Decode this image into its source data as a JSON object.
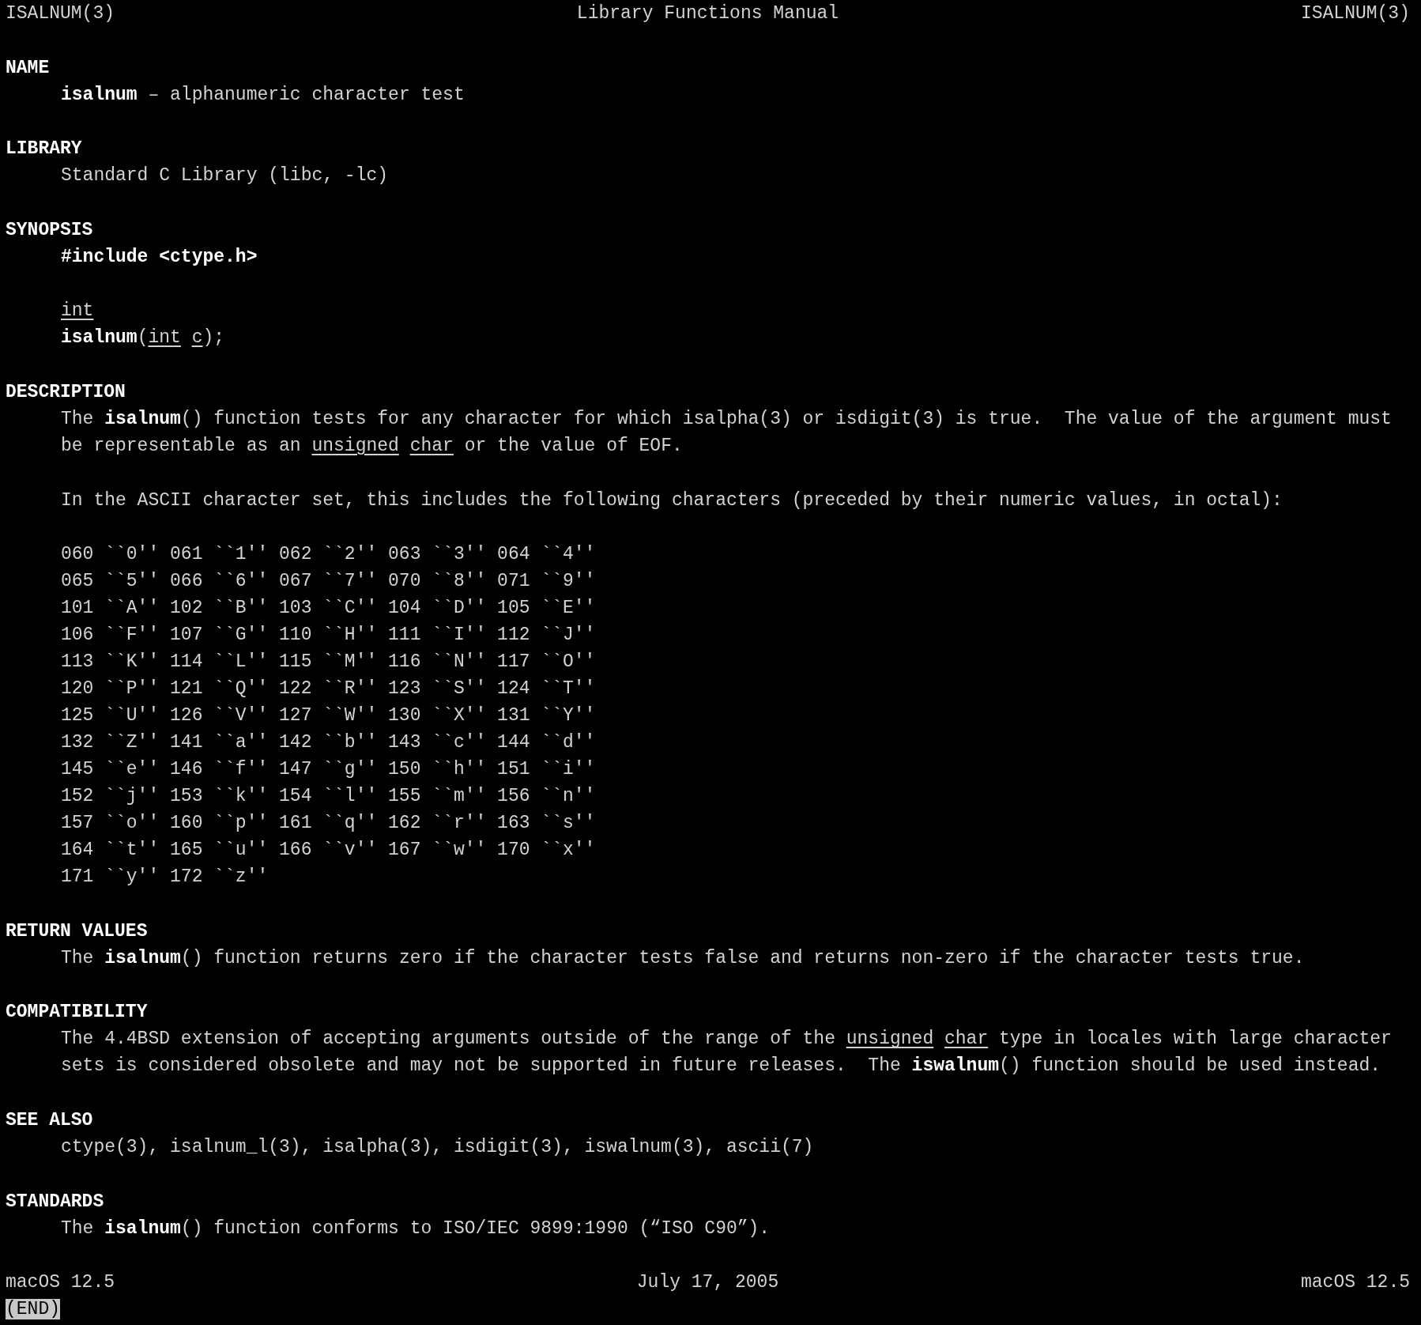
{
  "header": {
    "left": "ISALNUM(3)",
    "center": "Library Functions Manual",
    "right": "ISALNUM(3)"
  },
  "sections": [
    {
      "heading": "NAME",
      "paragraphs": [
        [
          [
            {
              "text": "isalnum",
              "kind": "bold"
            },
            {
              "text": " – alphanumeric character test",
              "kind": "plain"
            }
          ]
        ]
      ]
    },
    {
      "heading": "LIBRARY",
      "paragraphs": [
        [
          [
            {
              "text": "Standard C Library (libc, -lc)",
              "kind": "plain"
            }
          ]
        ]
      ]
    },
    {
      "heading": "SYNOPSIS",
      "paragraphs": [
        [
          [
            {
              "text": "#include <ctype.h>",
              "kind": "bold"
            }
          ]
        ],
        [
          [
            {
              "text": "int",
              "kind": "underline"
            }
          ],
          [
            {
              "text": "isalnum",
              "kind": "bold"
            },
            {
              "text": "(",
              "kind": "plain"
            },
            {
              "text": "int c",
              "kind": "underline"
            },
            {
              "text": ");",
              "kind": "plain"
            }
          ]
        ]
      ]
    },
    {
      "heading": "DESCRIPTION",
      "paragraphs": [
        [
          [
            {
              "text": "The ",
              "kind": "plain"
            },
            {
              "text": "isalnum",
              "kind": "bold"
            },
            {
              "text": "() function tests for any character for which isalpha(3) or isdigit(3) is true.  The value of the argument must",
              "kind": "plain"
            }
          ],
          [
            {
              "text": "be representable as an ",
              "kind": "plain"
            },
            {
              "text": "unsigned char",
              "kind": "underline"
            },
            {
              "text": " or the value of EOF.",
              "kind": "plain"
            }
          ]
        ],
        [
          [
            {
              "text": "In the ASCII character set, this includes the following characters (preceded by their numeric values, in octal):",
              "kind": "plain"
            }
          ]
        ],
        [
          [
            {
              "text": "060 ``0'' 061 ``1'' 062 ``2'' 063 ``3'' 064 ``4''",
              "kind": "plain"
            }
          ],
          [
            {
              "text": "065 ``5'' 066 ``6'' 067 ``7'' 070 ``8'' 071 ``9''",
              "kind": "plain"
            }
          ],
          [
            {
              "text": "101 ``A'' 102 ``B'' 103 ``C'' 104 ``D'' 105 ``E''",
              "kind": "plain"
            }
          ],
          [
            {
              "text": "106 ``F'' 107 ``G'' 110 ``H'' 111 ``I'' 112 ``J''",
              "kind": "plain"
            }
          ],
          [
            {
              "text": "113 ``K'' 114 ``L'' 115 ``M'' 116 ``N'' 117 ``O''",
              "kind": "plain"
            }
          ],
          [
            {
              "text": "120 ``P'' 121 ``Q'' 122 ``R'' 123 ``S'' 124 ``T''",
              "kind": "plain"
            }
          ],
          [
            {
              "text": "125 ``U'' 126 ``V'' 127 ``W'' 130 ``X'' 131 ``Y''",
              "kind": "plain"
            }
          ],
          [
            {
              "text": "132 ``Z'' 141 ``a'' 142 ``b'' 143 ``c'' 144 ``d''",
              "kind": "plain"
            }
          ],
          [
            {
              "text": "145 ``e'' 146 ``f'' 147 ``g'' 150 ``h'' 151 ``i''",
              "kind": "plain"
            }
          ],
          [
            {
              "text": "152 ``j'' 153 ``k'' 154 ``l'' 155 ``m'' 156 ``n''",
              "kind": "plain"
            }
          ],
          [
            {
              "text": "157 ``o'' 160 ``p'' 161 ``q'' 162 ``r'' 163 ``s''",
              "kind": "plain"
            }
          ],
          [
            {
              "text": "164 ``t'' 165 ``u'' 166 ``v'' 167 ``w'' 170 ``x''",
              "kind": "plain"
            }
          ],
          [
            {
              "text": "171 ``y'' 172 ``z''",
              "kind": "plain"
            }
          ]
        ]
      ]
    },
    {
      "heading": "RETURN VALUES",
      "paragraphs": [
        [
          [
            {
              "text": "The ",
              "kind": "plain"
            },
            {
              "text": "isalnum",
              "kind": "bold"
            },
            {
              "text": "() function returns zero if the character tests false and returns non-zero if the character tests true.",
              "kind": "plain"
            }
          ]
        ]
      ]
    },
    {
      "heading": "COMPATIBILITY",
      "paragraphs": [
        [
          [
            {
              "text": "The 4.4BSD extension of accepting arguments outside of the range of the ",
              "kind": "plain"
            },
            {
              "text": "unsigned char",
              "kind": "underline"
            },
            {
              "text": " type in locales with large character",
              "kind": "plain"
            }
          ],
          [
            {
              "text": "sets is considered obsolete and may not be supported in future releases.  The ",
              "kind": "plain"
            },
            {
              "text": "iswalnum",
              "kind": "bold"
            },
            {
              "text": "() function should be used instead.",
              "kind": "plain"
            }
          ]
        ]
      ]
    },
    {
      "heading": "SEE ALSO",
      "paragraphs": [
        [
          [
            {
              "text": "ctype(3), isalnum_l(3), isalpha(3), isdigit(3), iswalnum(3), ascii(7)",
              "kind": "plain"
            }
          ]
        ]
      ]
    },
    {
      "heading": "STANDARDS",
      "paragraphs": [
        [
          [
            {
              "text": "The ",
              "kind": "plain"
            },
            {
              "text": "isalnum",
              "kind": "bold"
            },
            {
              "text": "() function conforms to ISO/IEC 9899:1990 (“ISO C90”).",
              "kind": "plain"
            }
          ]
        ]
      ]
    }
  ],
  "footer": {
    "left": "macOS 12.5",
    "center": "July 17, 2005",
    "right": "macOS 12.5"
  },
  "pager_status": "(END)"
}
